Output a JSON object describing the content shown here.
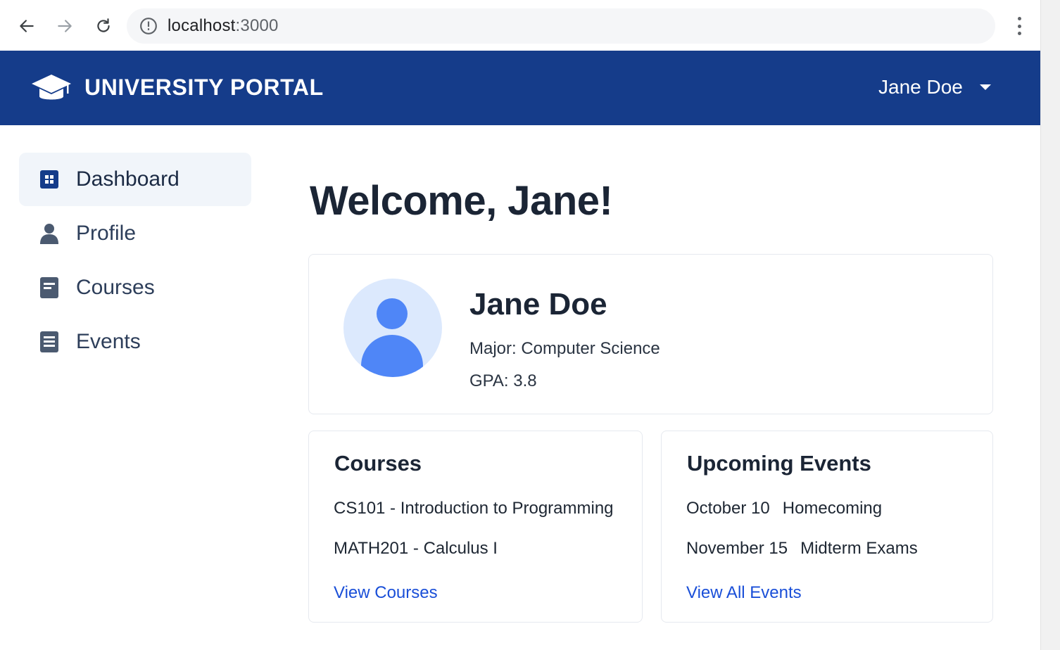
{
  "browser": {
    "url_host": "localhost",
    "url_port": ":3000"
  },
  "header": {
    "brand": "UNIVERSITY PORTAL",
    "user_name": "Jane Doe",
    "logo_icon": "graduation-cap-icon"
  },
  "sidebar": {
    "items": [
      {
        "label": "Dashboard",
        "icon": "dashboard-grid-icon",
        "active": true
      },
      {
        "label": "Profile",
        "icon": "user-icon",
        "active": false
      },
      {
        "label": "Courses",
        "icon": "book-icon",
        "active": false
      },
      {
        "label": "Events",
        "icon": "calendar-list-icon",
        "active": false
      }
    ]
  },
  "main": {
    "welcome": "Welcome, Jane!",
    "profile": {
      "name": "Jane Doe",
      "major": "Major: Computer Science",
      "gpa": "GPA: 3.8"
    },
    "courses": {
      "title": "Courses",
      "items": [
        "CS101 - Introduction to Programming",
        "MATH201 - Calculus I"
      ],
      "link": "View Courses"
    },
    "events": {
      "title": "Upcoming Events",
      "items": [
        {
          "date": "October 10",
          "name": "Homecoming"
        },
        {
          "date": "November 15",
          "name": "Midterm Exams"
        }
      ],
      "link": "View All Events"
    }
  },
  "colors": {
    "header_bg": "#153c8a",
    "link": "#1a4fd8",
    "avatar_accent": "#4f86f7"
  }
}
